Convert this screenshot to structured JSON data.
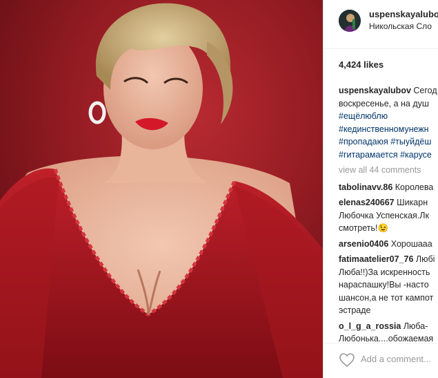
{
  "post": {
    "username": "uspenskayalubov",
    "location": "Никольская Сло",
    "likes": "4,424 likes",
    "caption": {
      "user": "uspenskayalubov",
      "text_line1": "Сегод",
      "text_line2": "воскресенье, а на душ",
      "tags": [
        "#ещёлюблю",
        "#кединственномунежн",
        "#пропадаюя",
        "#тыуйдёш",
        "#гитарамается",
        "#карусе"
      ]
    },
    "view_all": "view all 44 comments",
    "comments": [
      {
        "user": "tabolinavv.86",
        "lines": [
          "Королева"
        ]
      },
      {
        "user": "elenas240667",
        "lines": [
          "Шикарн",
          "Любочка Успенская.Лк",
          "смотреть!😉"
        ]
      },
      {
        "user": "arsenio0406",
        "lines": [
          "Хорошааа"
        ]
      },
      {
        "user": "fatimaatelier07_76",
        "lines": [
          "Любі",
          "Люба!!)За искренность",
          "нараспашку!Вы -насто",
          "шансон,а не тот кампот",
          "эстраде"
        ]
      },
      {
        "user": "o_l_g_a_rossia",
        "lines": [
          "Люба-",
          "Любонька....обожаемая"
        ]
      }
    ],
    "add_comment_placeholder": "Add a comment..."
  },
  "icons": {
    "heart": "heart-outline-icon"
  }
}
